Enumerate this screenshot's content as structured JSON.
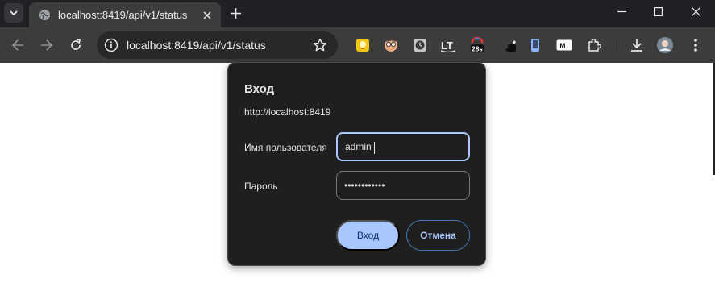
{
  "browser": {
    "tab": {
      "title": "localhost:8419/api/v1/status"
    },
    "omnibox": {
      "url": "localhost:8419/api/v1/status"
    },
    "extensions": [
      {
        "name": "yellow-bulb-icon",
        "color": "#f5c518"
      },
      {
        "name": "face-mask-icon",
        "color": "#e8a87c"
      },
      {
        "name": "clock-icon",
        "color": "#c4c7c5"
      },
      {
        "name": "lt-icon",
        "label": "LT"
      },
      {
        "name": "timer-badge-icon",
        "label": "28s"
      },
      {
        "name": "pen-icon"
      },
      {
        "name": "phone-icon"
      },
      {
        "name": "markdown-icon",
        "label": "M↓"
      },
      {
        "name": "puzzle-icon"
      }
    ]
  },
  "dialog": {
    "title": "Вход",
    "origin": "http://localhost:8419",
    "username_label": "Имя пользователя",
    "username_value": "admin",
    "password_label": "Пароль",
    "password_value": "••••••••••••",
    "submit_label": "Вход",
    "cancel_label": "Отмена"
  },
  "colors": {
    "accent": "#a8c7fa",
    "dialog_bg": "#1f1f1f",
    "toolbar_bg": "#3c3c3c",
    "tabstrip_bg": "#202124"
  }
}
